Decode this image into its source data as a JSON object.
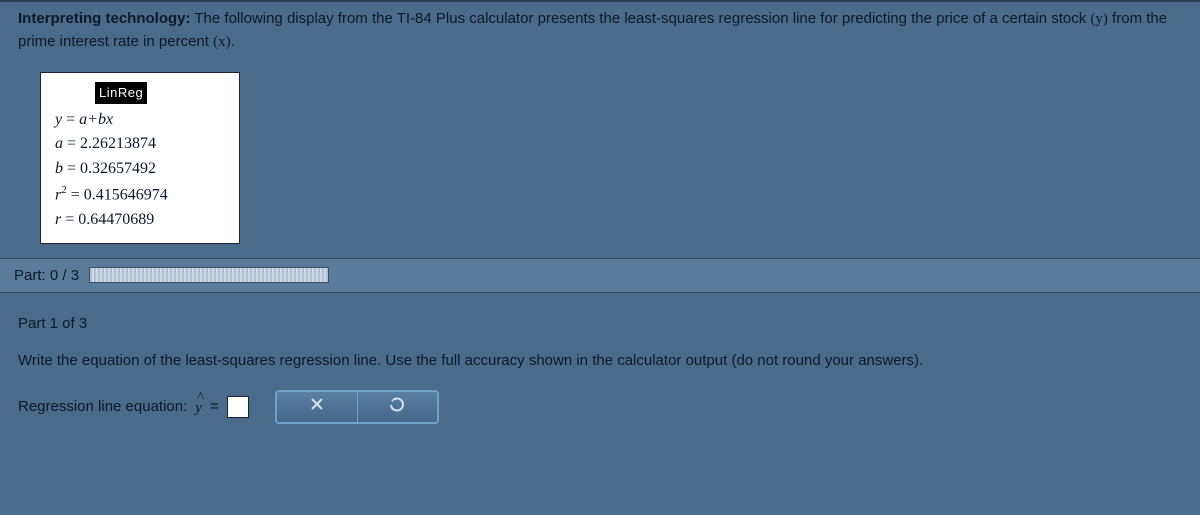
{
  "intro": {
    "heading": "Interpreting technology:",
    "text1": " The following display from the TI-84 Plus calculator presents the least-squares regression line for predicting the price of a certain stock ",
    "yvar": "(y)",
    "text2": " from the prime interest rate in percent ",
    "xvar": "(x)",
    "text3": "."
  },
  "calc": {
    "title": "LinReg",
    "eq_lhs": "y",
    "eq_rhs": "a+bx",
    "a_label": "a",
    "a_val": "2.26213874",
    "b_label": "b",
    "b_val": "0.32657492",
    "r2_label": "r",
    "r2_exp": "2",
    "r2_val": "0.415646974",
    "r_label": "r",
    "r_val": "0.64470689"
  },
  "parts": {
    "progress_label": "Part: 0 / 3",
    "title": "Part 1 of 3",
    "prompt": "Write the equation of the least-squares regression line. Use the full accuracy shown in the calculator output (do not round your answers).",
    "answer_label": "Regression line equation: ",
    "yhat": "y",
    "equals": " ="
  },
  "actions": {
    "clear": "×",
    "reset": "↶"
  }
}
